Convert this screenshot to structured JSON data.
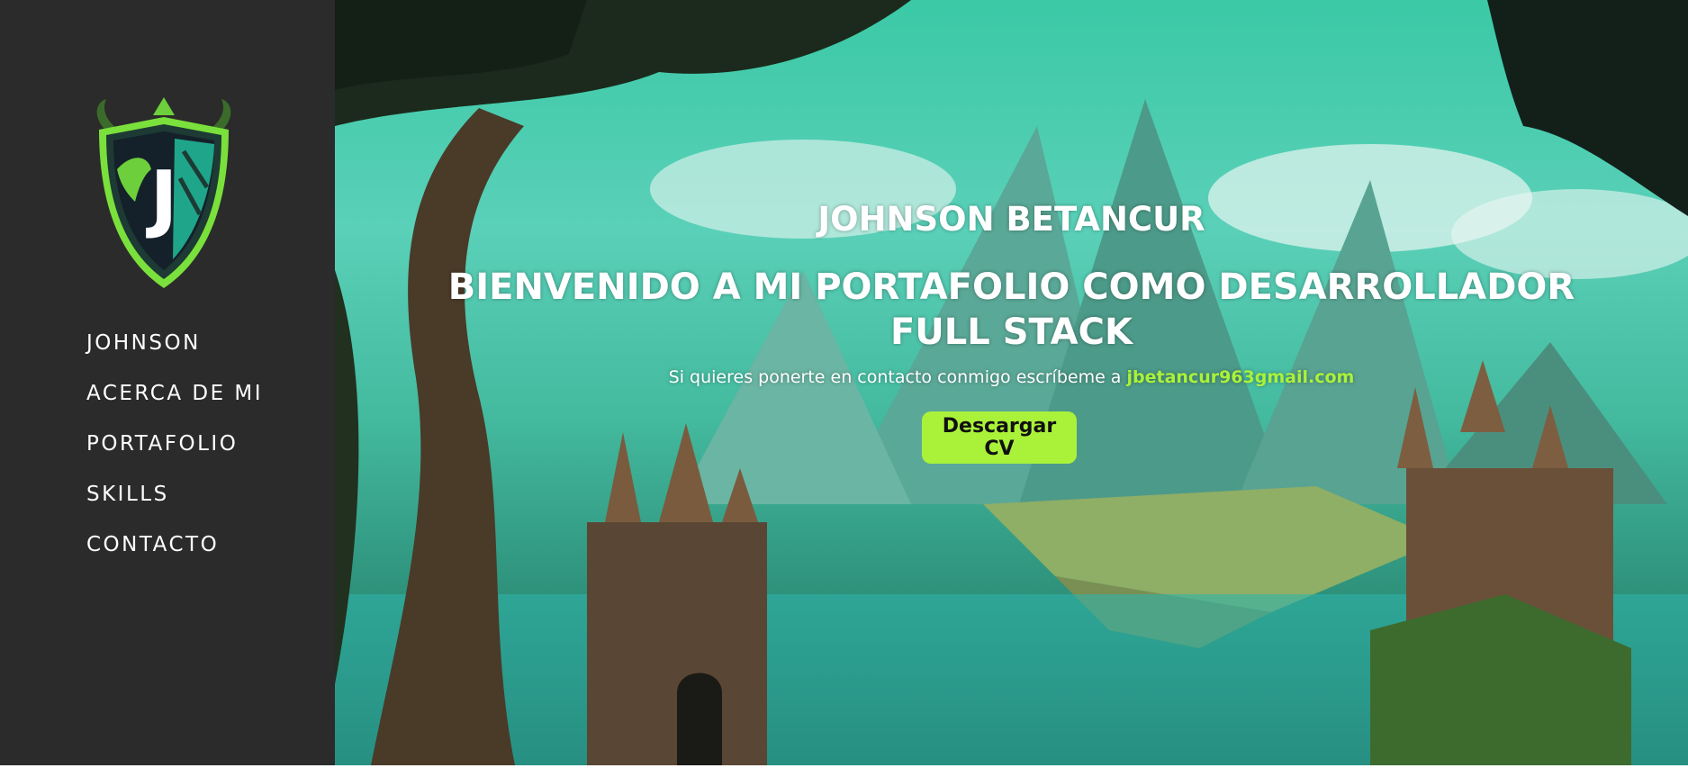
{
  "sidebar": {
    "logo": {
      "icon": "dragon-shield-icon",
      "letter": "J"
    },
    "nav": [
      "JOHNSON",
      "ACERCA DE MI",
      "PORTAFOLIO",
      "SKILLS",
      "CONTACTO"
    ]
  },
  "hero": {
    "name": "JOHNSON BETANCUR",
    "headline": "BIENVENIDO A MI PORTAFOLIO COMO DESARROLLADOR FULL STACK",
    "contact_text": "Si quieres ponerte en contacto conmigo escríbeme a ",
    "email": "jbetancur963gmail.com",
    "cta_label": "Descargar CV"
  },
  "colors": {
    "sidebar_bg": "#2b2b2b",
    "accent": "#aaf23a",
    "text": "#ffffff"
  }
}
